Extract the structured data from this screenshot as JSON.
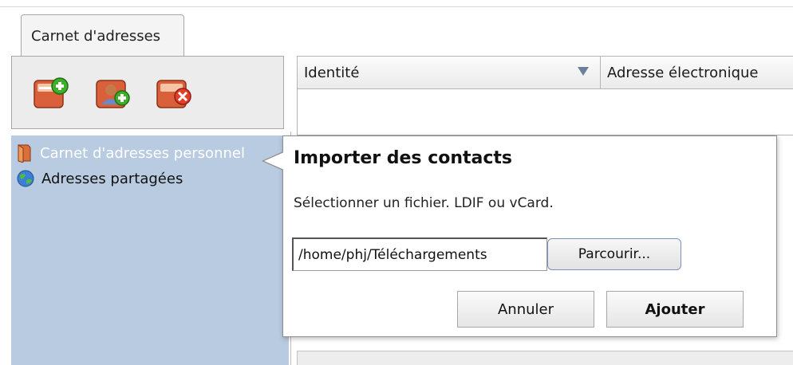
{
  "tabs": [
    {
      "label": "Carnet d'adresses"
    }
  ],
  "toolbar": {
    "buttons": [
      {
        "icon": "address-book-add-icon"
      },
      {
        "icon": "contact-add-icon"
      },
      {
        "icon": "address-book-delete-icon"
      }
    ]
  },
  "addressbooks": [
    {
      "label": "Carnet d'adresses personnel",
      "icon": "book-icon",
      "selected": true
    },
    {
      "label": "Adresses partagées",
      "icon": "globe-icon",
      "selected": false
    }
  ],
  "table": {
    "columns": [
      "Identité",
      "Adresse électronique"
    ]
  },
  "dialog": {
    "title": "Importer des contacts",
    "description": "Sélectionner un fichier. LDIF ou vCard.",
    "file_value": "/home/phj/Téléchargements",
    "browse_label": "Parcourir...",
    "cancel_label": "Annuler",
    "add_label": "Ajouter"
  },
  "colors": {
    "selection_bg": "#b8cbe1",
    "toolbar_bg": "#ececec",
    "icon_book": "#d9603a",
    "icon_add": "#3fae2a",
    "icon_delete": "#e0402a"
  }
}
